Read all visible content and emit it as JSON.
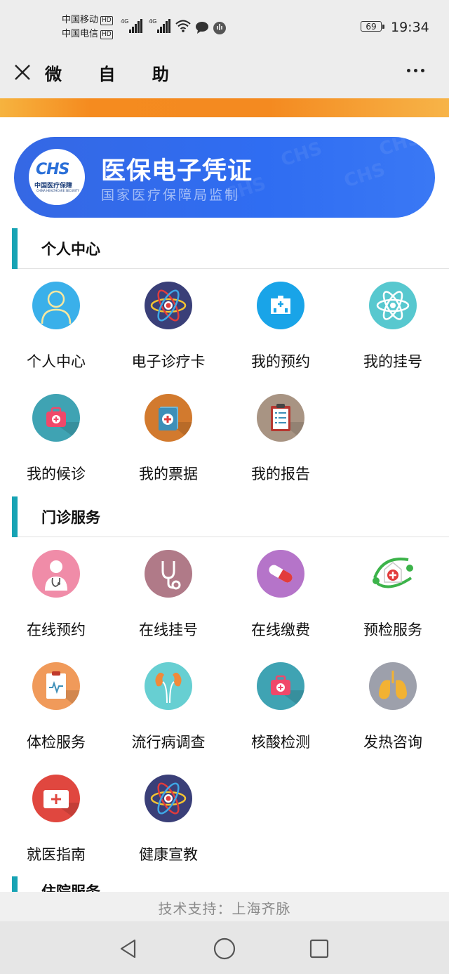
{
  "status_bar": {
    "carrier1": "中国移动",
    "carrier2": "中国电信",
    "hd": "HD",
    "network1": "4G",
    "network2": "4G",
    "battery": "69",
    "time": "19:34"
  },
  "nav": {
    "title": "微 自 助"
  },
  "banner": {
    "logo_text": "CHS",
    "logo_cn": "中国医疗保障",
    "logo_en": "CHINA HEALTHCARE SECURITY",
    "title": "医保电子凭证",
    "subtitle": "国家医疗保障局监制"
  },
  "sections": [
    {
      "title": "个人中心",
      "items": [
        {
          "label": "个人中心",
          "icon": "person-icon",
          "color": "#3ab0ea"
        },
        {
          "label": "电子诊疗卡",
          "icon": "atom-icon",
          "color": "#3a3f78"
        },
        {
          "label": "我的预约",
          "icon": "hospital-icon",
          "color": "#19a4e8"
        },
        {
          "label": "我的挂号",
          "icon": "atom-outline-icon",
          "color": "#57c8cf"
        },
        {
          "label": "我的候诊",
          "icon": "medkit-icon",
          "color": "#3fa3b3"
        },
        {
          "label": "我的票据",
          "icon": "medical-book-icon",
          "color": "#d27a2e"
        },
        {
          "label": "我的报告",
          "icon": "clipboard-icon",
          "color": "#a89483"
        }
      ]
    },
    {
      "title": "门诊服务",
      "items": [
        {
          "label": "在线预约",
          "icon": "doctor-icon",
          "color": "#f08ca8"
        },
        {
          "label": "在线挂号",
          "icon": "stethoscope-icon",
          "color": "#b07a88"
        },
        {
          "label": "在线缴费",
          "icon": "pill-icon",
          "color": "#b574c9"
        },
        {
          "label": "预检服务",
          "icon": "medical-cross-logo-icon",
          "color": "#ffffff"
        },
        {
          "label": "体检服务",
          "icon": "health-report-icon",
          "color": "#f09a5a"
        },
        {
          "label": "流行病调查",
          "icon": "kidneys-icon",
          "color": "#67cfd2"
        },
        {
          "label": "核酸检测",
          "icon": "medkit-icon",
          "color": "#3fa3b3"
        },
        {
          "label": "发热咨询",
          "icon": "lungs-icon",
          "color": "#9da0ab"
        },
        {
          "label": "就医指南",
          "icon": "first-aid-box-icon",
          "color": "#e0473f"
        },
        {
          "label": "健康宣教",
          "icon": "atom-icon",
          "color": "#3a3f78"
        }
      ]
    }
  ],
  "next_section_title": "住院服务",
  "footer": {
    "text": "技术支持：上海齐脉"
  }
}
